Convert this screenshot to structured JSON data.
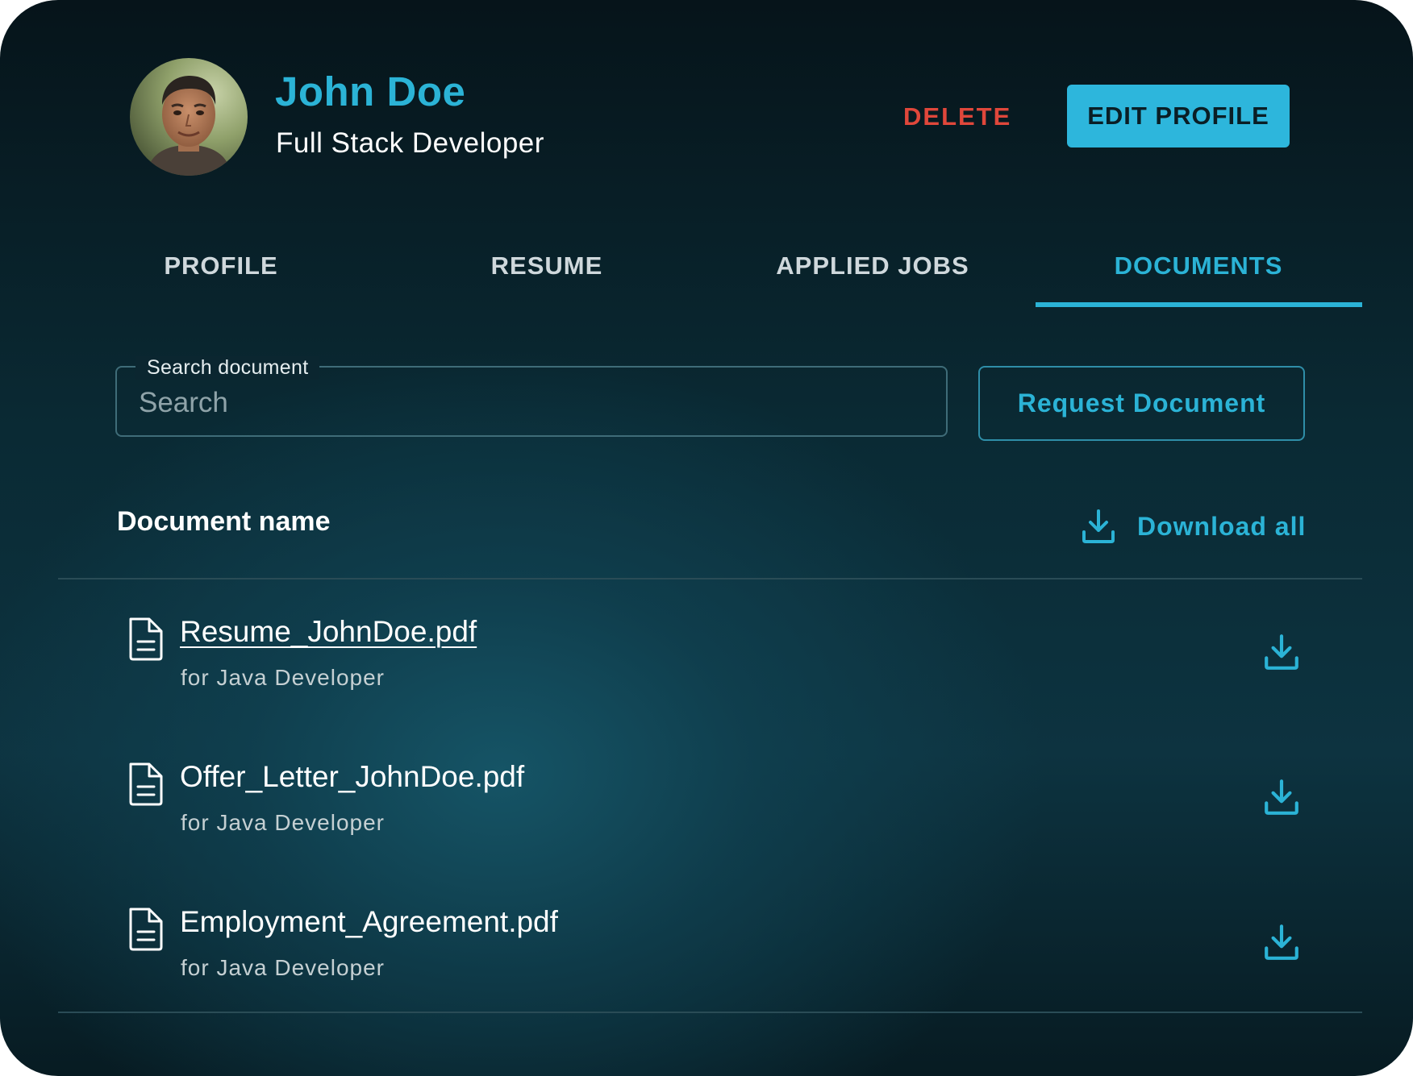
{
  "profile": {
    "name": "John Doe",
    "role": "Full Stack Developer"
  },
  "actions": {
    "delete_label": "DELETE",
    "edit_label": "EDIT PROFILE"
  },
  "tabs": [
    {
      "label": "PROFILE",
      "active": false
    },
    {
      "label": "RESUME",
      "active": false
    },
    {
      "label": "APPLIED JOBS",
      "active": false
    },
    {
      "label": "DOCUMENTS",
      "active": true
    }
  ],
  "search": {
    "legend": "Search document",
    "placeholder": "Search",
    "value": ""
  },
  "request_button_label": "Request Document",
  "documents_table": {
    "header": "Document name",
    "download_all_label": "Download all",
    "rows": [
      {
        "name": "Resume_JohnDoe.pdf",
        "subtitle": "for Java Developer",
        "icon": "file-icon",
        "action_icon": "download-icon"
      },
      {
        "name": "Offer_Letter_JohnDoe.pdf",
        "subtitle": "for Java Developer",
        "icon": "file-icon",
        "action_icon": "download-icon"
      },
      {
        "name": "Employment_Agreement.pdf",
        "subtitle": "for Java Developer",
        "icon": "file-icon",
        "action_icon": "download-icon"
      }
    ]
  },
  "colors": {
    "accent": "#2bb3d6",
    "danger": "#e0473b",
    "background_dark": "#06141a",
    "background_teal": "#165668",
    "text_primary": "#ffffff",
    "text_secondary": "#c5d0d3"
  }
}
